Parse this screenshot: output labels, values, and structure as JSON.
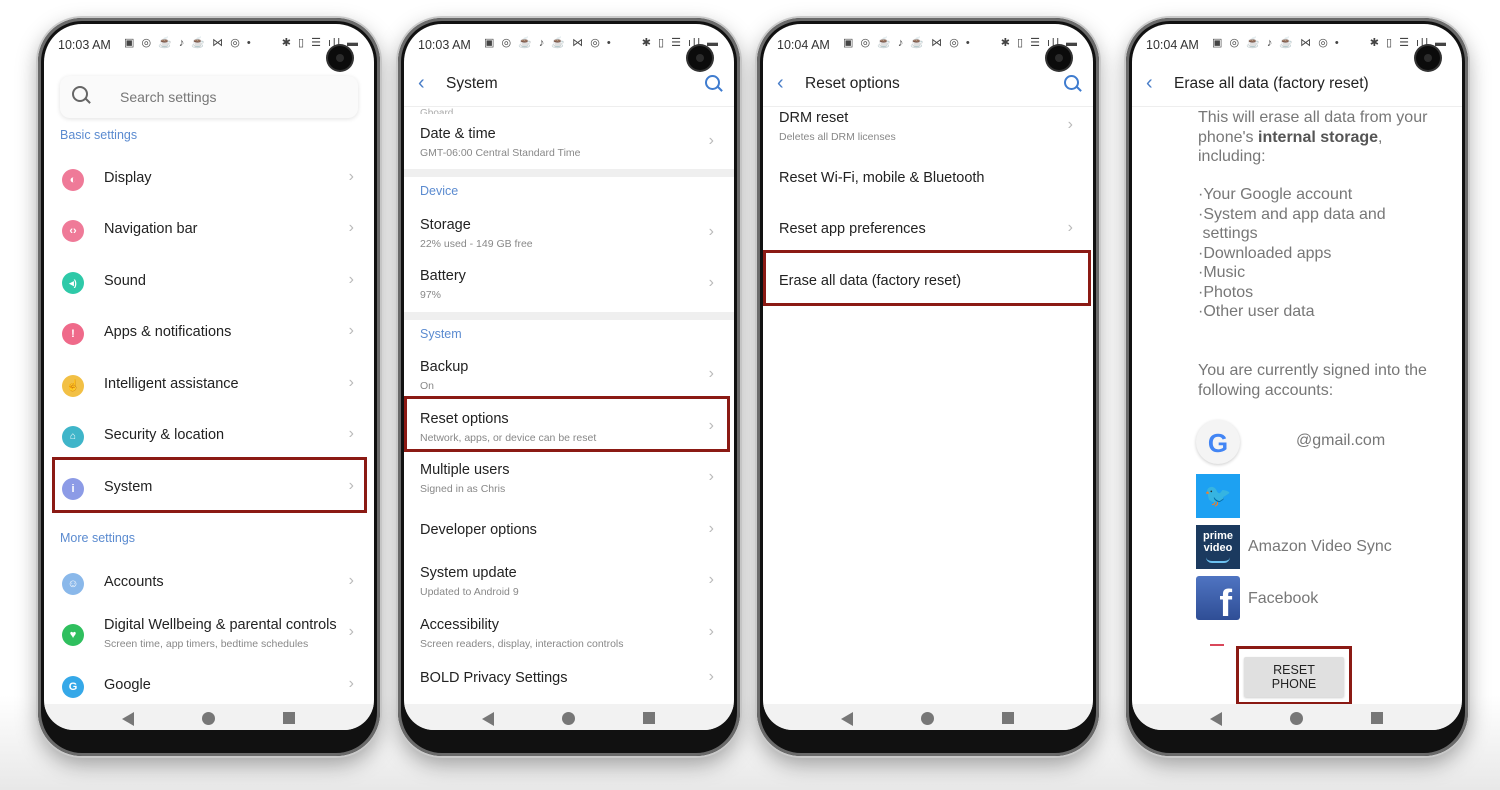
{
  "status_bar": {
    "time_1": "10:03 AM",
    "time_2": "10:03 AM",
    "time_3": "10:04 AM",
    "time_4": "10:04 AM",
    "left_icons": "▣ ◎ ☕ ♪ ☕ ⋈ ◎ •",
    "right_icons": "✱ ▯ ☰ ıll ▬"
  },
  "screen1": {
    "search_placeholder": "Search settings",
    "section_basic": "Basic settings",
    "section_more": "More settings",
    "items": [
      {
        "label": "Display",
        "icon": "display-icon",
        "color": "#ef7a98",
        "glyph": "◐"
      },
      {
        "label": "Navigation bar",
        "icon": "navigation-bar-icon",
        "color": "#ef7a98",
        "glyph": "‹›"
      },
      {
        "label": "Sound",
        "icon": "sound-icon",
        "color": "#2ec9a8",
        "glyph": "◂)"
      },
      {
        "label": "Apps & notifications",
        "icon": "apps-notifications-icon",
        "color": "#ef6a8a",
        "glyph": "!"
      },
      {
        "label": "Intelligent assistance",
        "icon": "intelligent-assistance-icon",
        "color": "#f2c045",
        "glyph": "☝"
      },
      {
        "label": "Security & location",
        "icon": "security-location-icon",
        "color": "#3fb5c9",
        "glyph": "🔓"
      },
      {
        "label": "System",
        "icon": "system-icon",
        "color": "#8c9be6",
        "glyph": "i"
      }
    ],
    "more_items": [
      {
        "label": "Accounts",
        "icon": "accounts-icon",
        "color": "#8ab8ea",
        "glyph": "☺"
      },
      {
        "label": "Digital Wellbeing & parental controls",
        "sub": "Screen time, app timers, bedtime schedules",
        "icon": "digital-wellbeing-icon",
        "color": "#2fbf5e",
        "glyph": "♥"
      },
      {
        "label": "Google",
        "icon": "google-icon",
        "color": "#35a8e8",
        "glyph": "G"
      }
    ]
  },
  "screen2": {
    "title": "System",
    "cut_text": "Gboard",
    "date_time": {
      "label": "Date & time",
      "sub": "GMT-06:00 Central Standard Time"
    },
    "section_device": "Device",
    "storage": {
      "label": "Storage",
      "sub": "22% used - 149 GB free"
    },
    "battery": {
      "label": "Battery",
      "sub": "97%"
    },
    "section_system": "System",
    "items": [
      {
        "label": "Backup",
        "sub": "On"
      },
      {
        "label": "Reset options",
        "sub": "Network, apps, or device can be reset"
      },
      {
        "label": "Multiple users",
        "sub": "Signed in as Chris"
      },
      {
        "label": "Developer options",
        "sub": ""
      },
      {
        "label": "System update",
        "sub": "Updated to Android 9"
      },
      {
        "label": "Accessibility",
        "sub": "Screen readers, display, interaction controls"
      },
      {
        "label": "BOLD Privacy Settings",
        "sub": ""
      }
    ]
  },
  "screen3": {
    "title": "Reset options",
    "items": [
      {
        "label": "DRM reset",
        "sub": "Deletes all DRM licenses",
        "chevron": true
      },
      {
        "label": "Reset Wi-Fi, mobile & Bluetooth",
        "sub": "",
        "chevron": false
      },
      {
        "label": "Reset app preferences",
        "sub": "",
        "chevron": true
      },
      {
        "label": "Erase all data (factory reset)",
        "sub": "",
        "chevron": false
      }
    ]
  },
  "screen4": {
    "title": "Erase all data (factory reset)",
    "intro_1": "This will erase all data from your phone's ",
    "intro_bold": "internal storage",
    "intro_2": ", including:",
    "bullets": [
      "·Your Google account",
      "·System and app data and",
      " settings",
      "·Downloaded apps",
      "·Music",
      "·Photos",
      "·Other user data"
    ],
    "signed_in": "You are currently signed into the following accounts:",
    "accounts": [
      {
        "name": "@gmail.com",
        "icon": "google-account-icon"
      },
      {
        "name": "",
        "icon": "twitter-icon"
      },
      {
        "name": "Amazon Video Sync",
        "icon": "prime-video-icon",
        "logo_line1": "prime",
        "logo_line2": "video"
      },
      {
        "name": "Facebook",
        "icon": "facebook-icon",
        "logo": "f"
      }
    ],
    "reset_button": "RESET PHONE"
  },
  "colors": {
    "highlight": "#8b1a14",
    "accent": "#4a7ec8",
    "section": "#5b8bd0"
  }
}
